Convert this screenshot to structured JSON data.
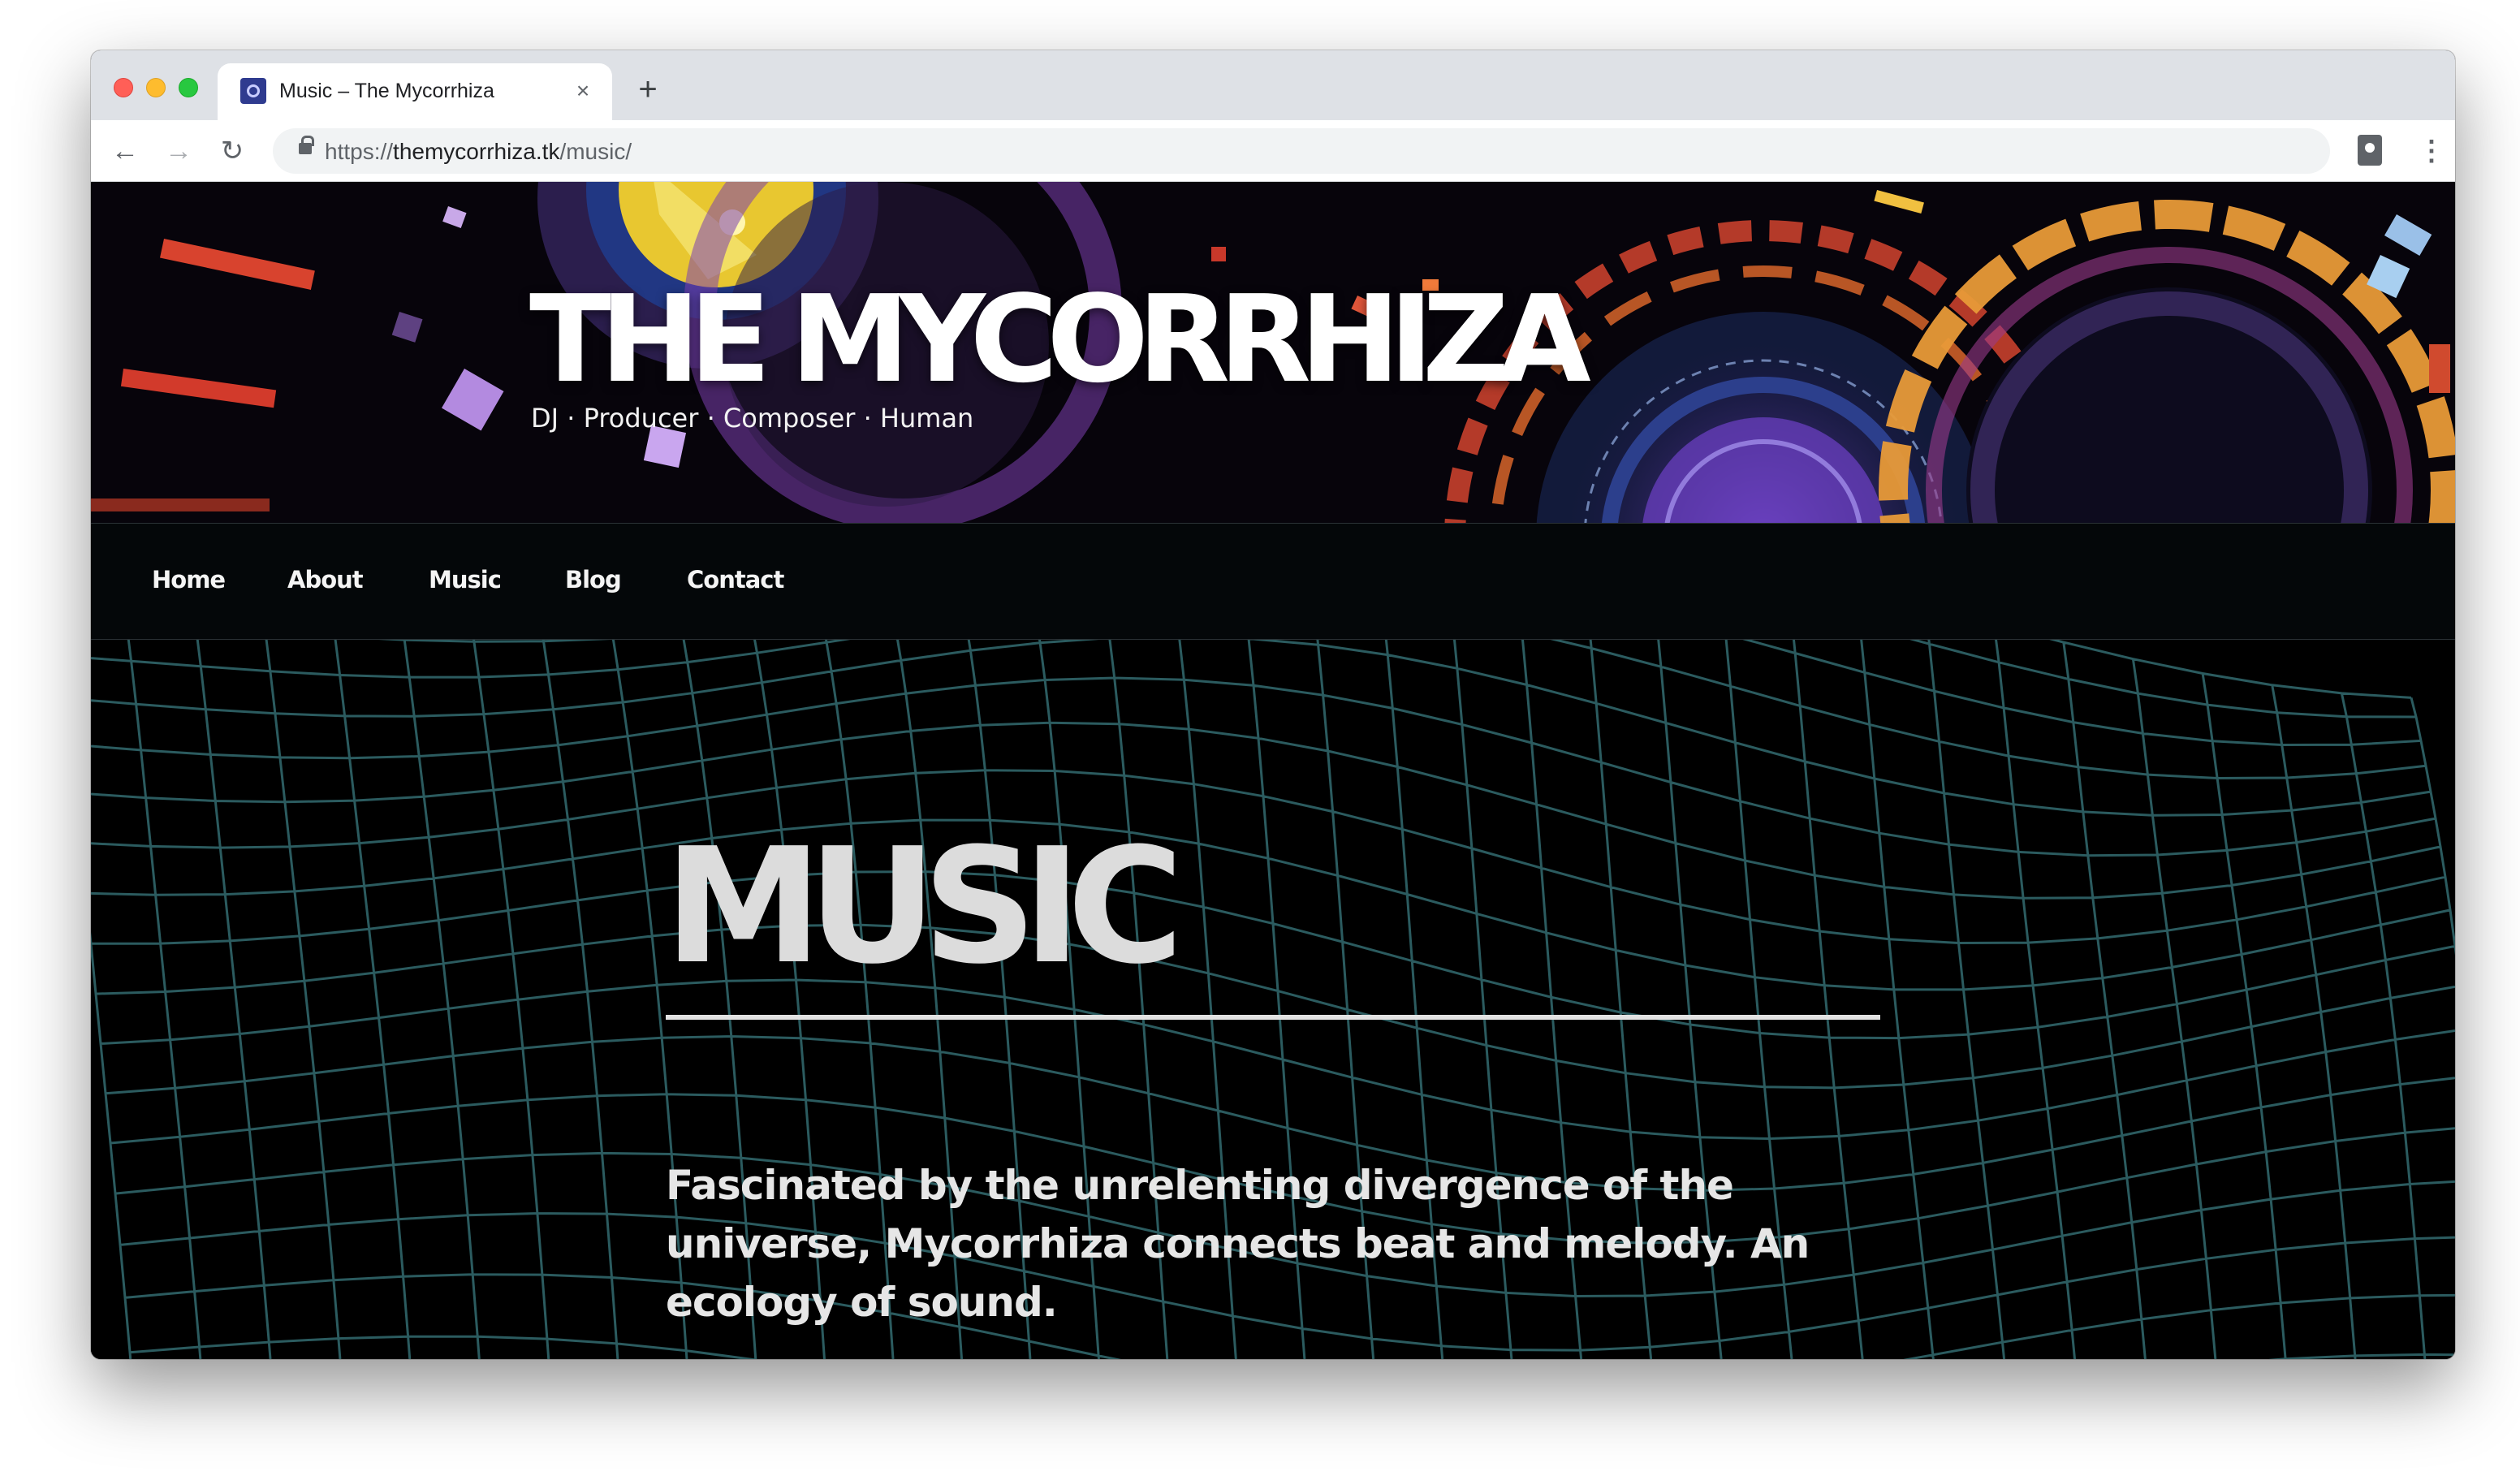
{
  "browser": {
    "tab_title": "Music – The Mycorrhiza",
    "tab_close": "×",
    "new_tab": "+",
    "url_scheme": "https://",
    "url_host": "themycorrhiza.tk",
    "url_path": "/music/",
    "back": "←",
    "forward": "→",
    "reload": "↻",
    "menu": "⋮"
  },
  "site": {
    "title": "THE MYCORRHIZA",
    "tagline": "DJ · Producer · Composer · Human"
  },
  "nav": {
    "items": [
      {
        "label": "Home"
      },
      {
        "label": "About"
      },
      {
        "label": "Music"
      },
      {
        "label": "Blog"
      },
      {
        "label": "Contact"
      }
    ]
  },
  "main": {
    "heading": "MUSIC",
    "intro": "Fascinated by the unrelenting divergence of the universe, Mycorrhiza connects beat and melody. An ecology of sound."
  },
  "colors": {
    "traffic_red": "#ff5f57",
    "traffic_yellow": "#febc2e",
    "traffic_green": "#28c840",
    "grid_teal": "#4fa6ad",
    "page_background": "#000000"
  },
  "icons": [
    "tab-favicon-icon",
    "close-icon",
    "plus-icon",
    "back-arrow-icon",
    "forward-arrow-icon",
    "reload-icon",
    "lock-icon",
    "extension-icon",
    "more-vert-icon"
  ]
}
